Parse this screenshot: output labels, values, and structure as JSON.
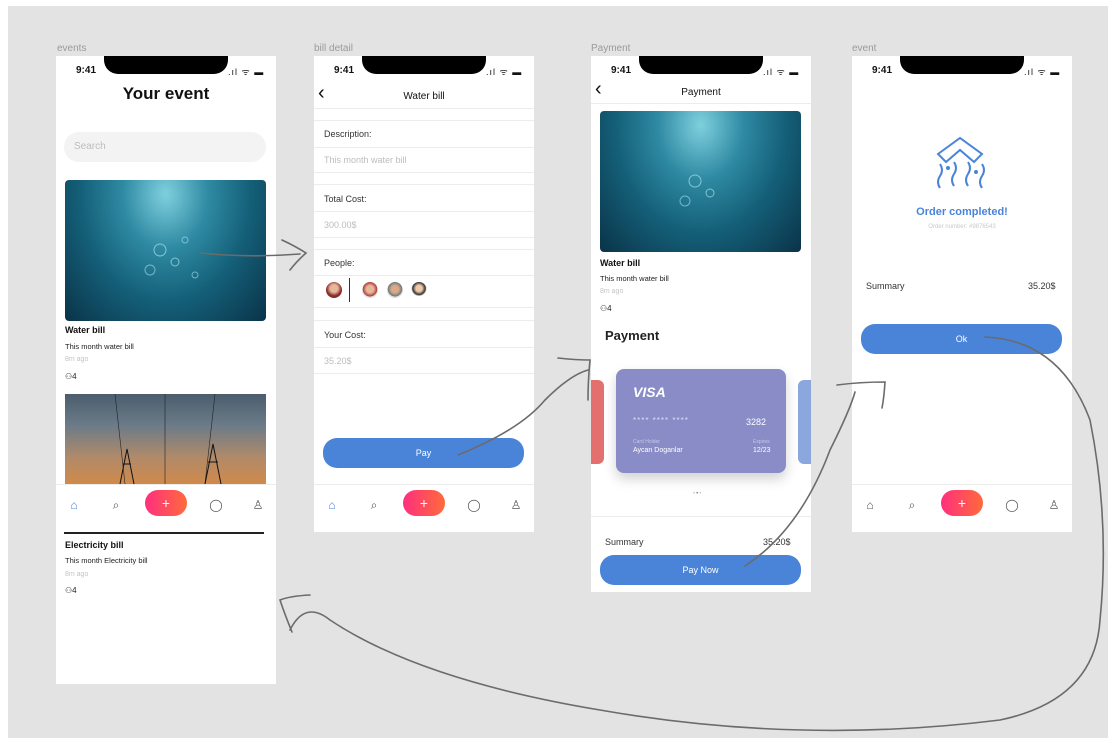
{
  "frames": {
    "events": "events",
    "bill_detail": "bill detail",
    "payment": "Payment",
    "event": "event"
  },
  "status": {
    "time": "9:41",
    "icons": ".ıl ᯤ ▬"
  },
  "screen1": {
    "title": "Your event",
    "search_placeholder": "Search",
    "cards": [
      {
        "title": "Water bill",
        "subtitle": "This month water bill",
        "time": "8m ago",
        "people": "4"
      },
      {
        "title": "Electricity bill",
        "subtitle": "This month Electricity bill",
        "time": "8m ago",
        "people": "4"
      }
    ]
  },
  "screen2": {
    "back": "‹",
    "header": "Water bill",
    "description_label": "Description:",
    "description_value": "This month water bill",
    "total_label": "Total Cost:",
    "total_value": "300.00$",
    "people_label": "People:",
    "your_cost_label": "Your Cost:",
    "your_cost_value": "35.20$",
    "pay_button": "Pay"
  },
  "screen3": {
    "back": "‹",
    "header": "Payment",
    "bill_title": "Water bill",
    "bill_subtitle": "This month water bill",
    "bill_time": "8m ago",
    "people": "4",
    "section_title": "Payment",
    "card": {
      "brand": "VISA",
      "number_mask": "****  ****  ****",
      "last4": "3282",
      "holder_label": "Card Holder",
      "holder_name": "Aycan Doganlar",
      "expires_label": "Expires",
      "expires_value": "12/23",
      "color": "#8a8cc7"
    },
    "summary_label": "Summary",
    "summary_value": "35.20$",
    "pay_now_button": "Pay Now"
  },
  "screen4": {
    "title": "Order completed!",
    "order_number": "Order number: #9876543",
    "summary_label": "Summary",
    "summary_value": "35.20$",
    "ok_button": "Ok"
  },
  "tabbar": {
    "home_icon": "⌂",
    "search_icon": "⌕",
    "add_icon": "+",
    "chat_icon": "◯",
    "profile_icon": "♙"
  },
  "colors": {
    "accent": "#4a84d9",
    "plus_gradient_start": "#ff2f7e",
    "plus_gradient_end": "#ff6a3c",
    "background": "#e3e3e3"
  }
}
